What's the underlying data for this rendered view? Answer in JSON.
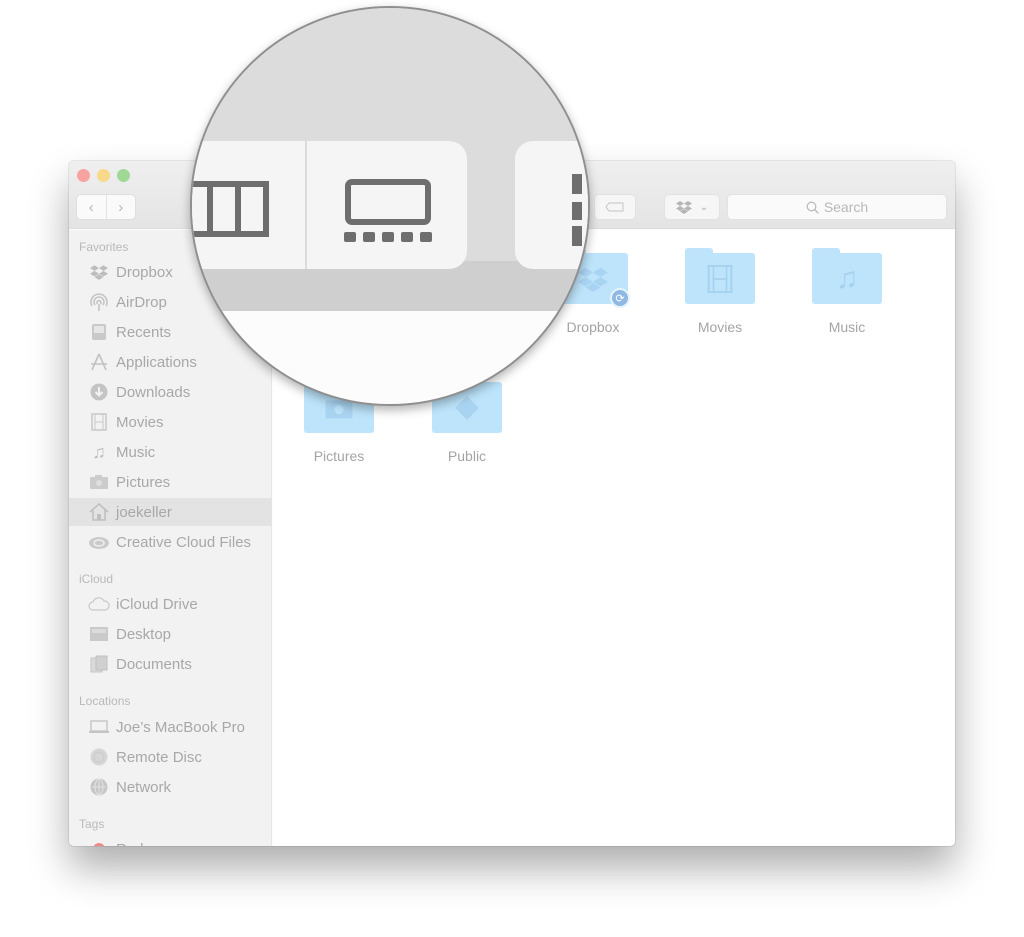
{
  "window": {
    "traffic_lights": {
      "close": "#f7a3a1",
      "minimize": "#f8d98a",
      "maximize": "#9fd995"
    },
    "nav": {
      "back_icon": "chevron-left-icon",
      "forward_icon": "chevron-right-icon",
      "back": "‹",
      "forward": "›"
    },
    "toolbar": {
      "tag_icon": "tag-icon",
      "dropbox_menu_icon": "dropbox-icon",
      "dropbox_menu_chevron": "⌄",
      "search": {
        "placeholder": "Search",
        "icon": "magnifier-icon"
      }
    }
  },
  "magnifier": {
    "description": "Zoomed view of toolbar view-mode buttons",
    "visible_buttons": [
      "column-view-icon",
      "gallery-view-icon",
      "arrange-icon"
    ]
  },
  "sidebar": {
    "sections": [
      {
        "title": "Favorites",
        "items": [
          {
            "label": "Dropbox",
            "icon": "dropbox-icon"
          },
          {
            "label": "AirDrop",
            "icon": "airdrop-icon"
          },
          {
            "label": "Recents",
            "icon": "recents-icon"
          },
          {
            "label": "Applications",
            "icon": "applications-icon"
          },
          {
            "label": "Downloads",
            "icon": "downloads-icon"
          },
          {
            "label": "Movies",
            "icon": "movies-icon"
          },
          {
            "label": "Music",
            "icon": "music-icon"
          },
          {
            "label": "Pictures",
            "icon": "camera-icon"
          },
          {
            "label": "joekeller",
            "icon": "home-icon",
            "selected": true
          },
          {
            "label": "Creative Cloud Files",
            "icon": "creative-cloud-icon"
          }
        ]
      },
      {
        "title": "iCloud",
        "items": [
          {
            "label": "iCloud Drive",
            "icon": "cloud-icon"
          },
          {
            "label": "Desktop",
            "icon": "desktop-icon"
          },
          {
            "label": "Documents",
            "icon": "documents-icon"
          }
        ]
      },
      {
        "title": "Locations",
        "items": [
          {
            "label": "Joe’s MacBook Pro",
            "icon": "laptop-icon"
          },
          {
            "label": "Remote Disc",
            "icon": "disc-icon"
          },
          {
            "label": "Network",
            "icon": "network-icon"
          }
        ]
      },
      {
        "title": "Tags",
        "items": [
          {
            "label": "Red",
            "icon": "red-tag-dot-icon",
            "color": "#f08a8a"
          }
        ]
      }
    ]
  },
  "content": {
    "folders": [
      {
        "label": "Dropbox",
        "icon": "dropbox-folder-icon",
        "badge": "sync-badge-icon"
      },
      {
        "label": "Movies",
        "icon": "movies-folder-icon"
      },
      {
        "label": "Music",
        "icon": "music-folder-icon"
      },
      {
        "label": "Pictures",
        "icon": "pictures-folder-icon"
      },
      {
        "label": "Public",
        "icon": "public-folder-icon"
      }
    ],
    "folder_color": "#bde4fb"
  }
}
